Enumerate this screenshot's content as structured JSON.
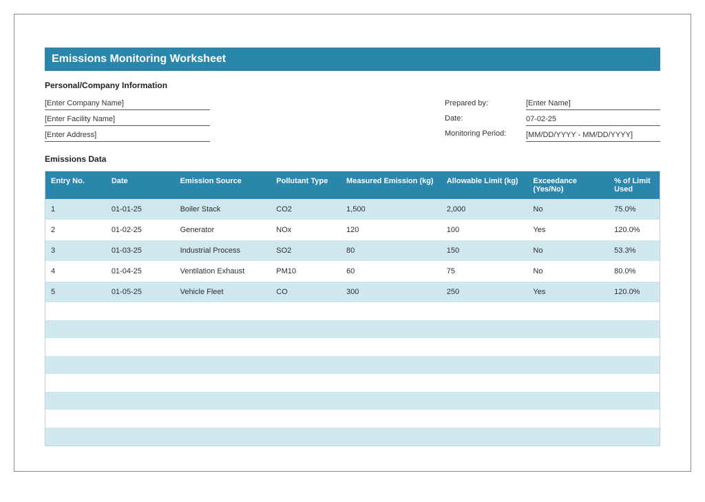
{
  "title": "Emissions Monitoring Worksheet",
  "sections": {
    "personal_info_heading": "Personal/Company Information",
    "emissions_data_heading": "Emissions Data"
  },
  "company_info": {
    "company_name": "[Enter Company Name]",
    "facility_name": "[Enter Facility Name]",
    "address": "[Enter Address]"
  },
  "meta_labels": {
    "prepared_by": "Prepared by:",
    "date": "Date:",
    "monitoring_period": "Monitoring Period:"
  },
  "meta_values": {
    "prepared_by": "[Enter Name]",
    "date": "07-02-25",
    "monitoring_period": "[MM/DD/YYYY - MM/DD/YYYY]"
  },
  "table": {
    "headers": {
      "entry_no": "Entry No.",
      "date": "Date",
      "emission_source": "Emission Source",
      "pollutant_type": "Pollutant Type",
      "measured_emission": "Measured Emission (kg)",
      "allowable_limit": "Allowable Limit (kg)",
      "exceedance": "Exceedance (Yes/No)",
      "pct_limit": "% of Limit Used"
    },
    "rows": [
      {
        "entry_no": "1",
        "date": "01-01-25",
        "source": "Boiler Stack",
        "pollutant": "CO2",
        "measured": "1,500",
        "limit": "2,000",
        "exceedance": "No",
        "pct": "75.0%"
      },
      {
        "entry_no": "2",
        "date": "01-02-25",
        "source": "Generator",
        "pollutant": "NOx",
        "measured": "120",
        "limit": "100",
        "exceedance": "Yes",
        "pct": "120.0%"
      },
      {
        "entry_no": "3",
        "date": "01-03-25",
        "source": "Industrial Process",
        "pollutant": "SO2",
        "measured": "80",
        "limit": "150",
        "exceedance": "No",
        "pct": "53.3%"
      },
      {
        "entry_no": "4",
        "date": "01-04-25",
        "source": "Ventilation Exhaust",
        "pollutant": "PM10",
        "measured": "60",
        "limit": "75",
        "exceedance": "No",
        "pct": "80.0%"
      },
      {
        "entry_no": "5",
        "date": "01-05-25",
        "source": "Vehicle Fleet",
        "pollutant": "CO",
        "measured": "300",
        "limit": "250",
        "exceedance": "Yes",
        "pct": "120.0%"
      }
    ],
    "empty_row_count": 8
  }
}
